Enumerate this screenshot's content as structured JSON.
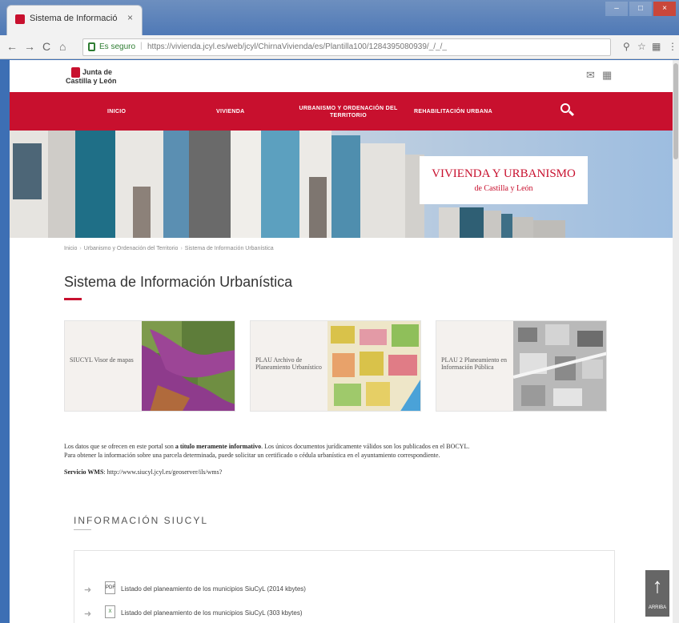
{
  "browser": {
    "tab_title": "Sistema de Información",
    "tab_close": "×",
    "window_controls": [
      "–",
      "□",
      "×"
    ],
    "back": "←",
    "forward": "→",
    "reload": "C",
    "home": "⌂",
    "secure_label": "Es seguro",
    "address_separator": "|",
    "url": "https://vivienda.jcyl.es/web/jcyl/ChirnaVivienda/es/Plantilla100/1284395080939/_/_/_",
    "toolbar_icons": [
      "search-icon",
      "star-icon",
      "extensions-icon",
      "menu-icon"
    ]
  },
  "header": {
    "logo_line1": "Junta de",
    "logo_line2": "Castilla y León",
    "icons": [
      "mail-icon",
      "grid-icon"
    ]
  },
  "nav": {
    "items": [
      "INICIO",
      "VIVIENDA",
      "URBANISMO Y ORDENACIÓN DEL TERRITORIO",
      "REHABILITACIÓN URBANA"
    ]
  },
  "hero": {
    "title": "VIVIENDA Y URBANISMO",
    "subtitle": "de Castilla y León"
  },
  "breadcrumb": [
    "Inicio",
    "Urbanismo y Ordenación del Territorio",
    "Sistema de Información Urbanística"
  ],
  "page_title": "Sistema de Información Urbanística",
  "cards": [
    {
      "label": "SIUCYL Visor de mapas",
      "accent": "#8e3b8c"
    },
    {
      "label": "PLAU Archivo de Planeamiento Urbanístico",
      "accent": "#d8c24a"
    },
    {
      "label": "PLAU 2 Planeamiento en Información Pública",
      "accent": "#8a8a8a"
    }
  ],
  "intro": {
    "line1_before": "Los datos que se ofrecen en este portal son ",
    "line1_bold": "a título meramente informativo",
    "line1_after": ". Los únicos documentos jurídicamente válidos son los publicados en el BOCYL.",
    "line2": "Para obtener la información sobre una parcela determinada, puede solicitar un certificado o cédula urbanística en el ayuntamiento correspondiente.",
    "wms_label": "Servicio WMS",
    "wms_value": ": http://www.siucyl.jcyl.es/geoserver/ils/wms?"
  },
  "siucyl": {
    "heading": "INFORMACIÓN SIUCYL",
    "items": [
      {
        "icon": "pdf-file-icon",
        "text": "Listado del planeamiento de los municipios SiuCyL (2014 kbytes)"
      },
      {
        "icon": "excel-file-icon",
        "text": "Listado del planeamiento de los municipios SiuCyL (303 kbytes)"
      }
    ]
  },
  "back_to_top": {
    "arrow": "↑",
    "label": "ARRIBA"
  },
  "colors": {
    "brand_red": "#c8102e",
    "browser_blue": "#3d6fb4"
  }
}
